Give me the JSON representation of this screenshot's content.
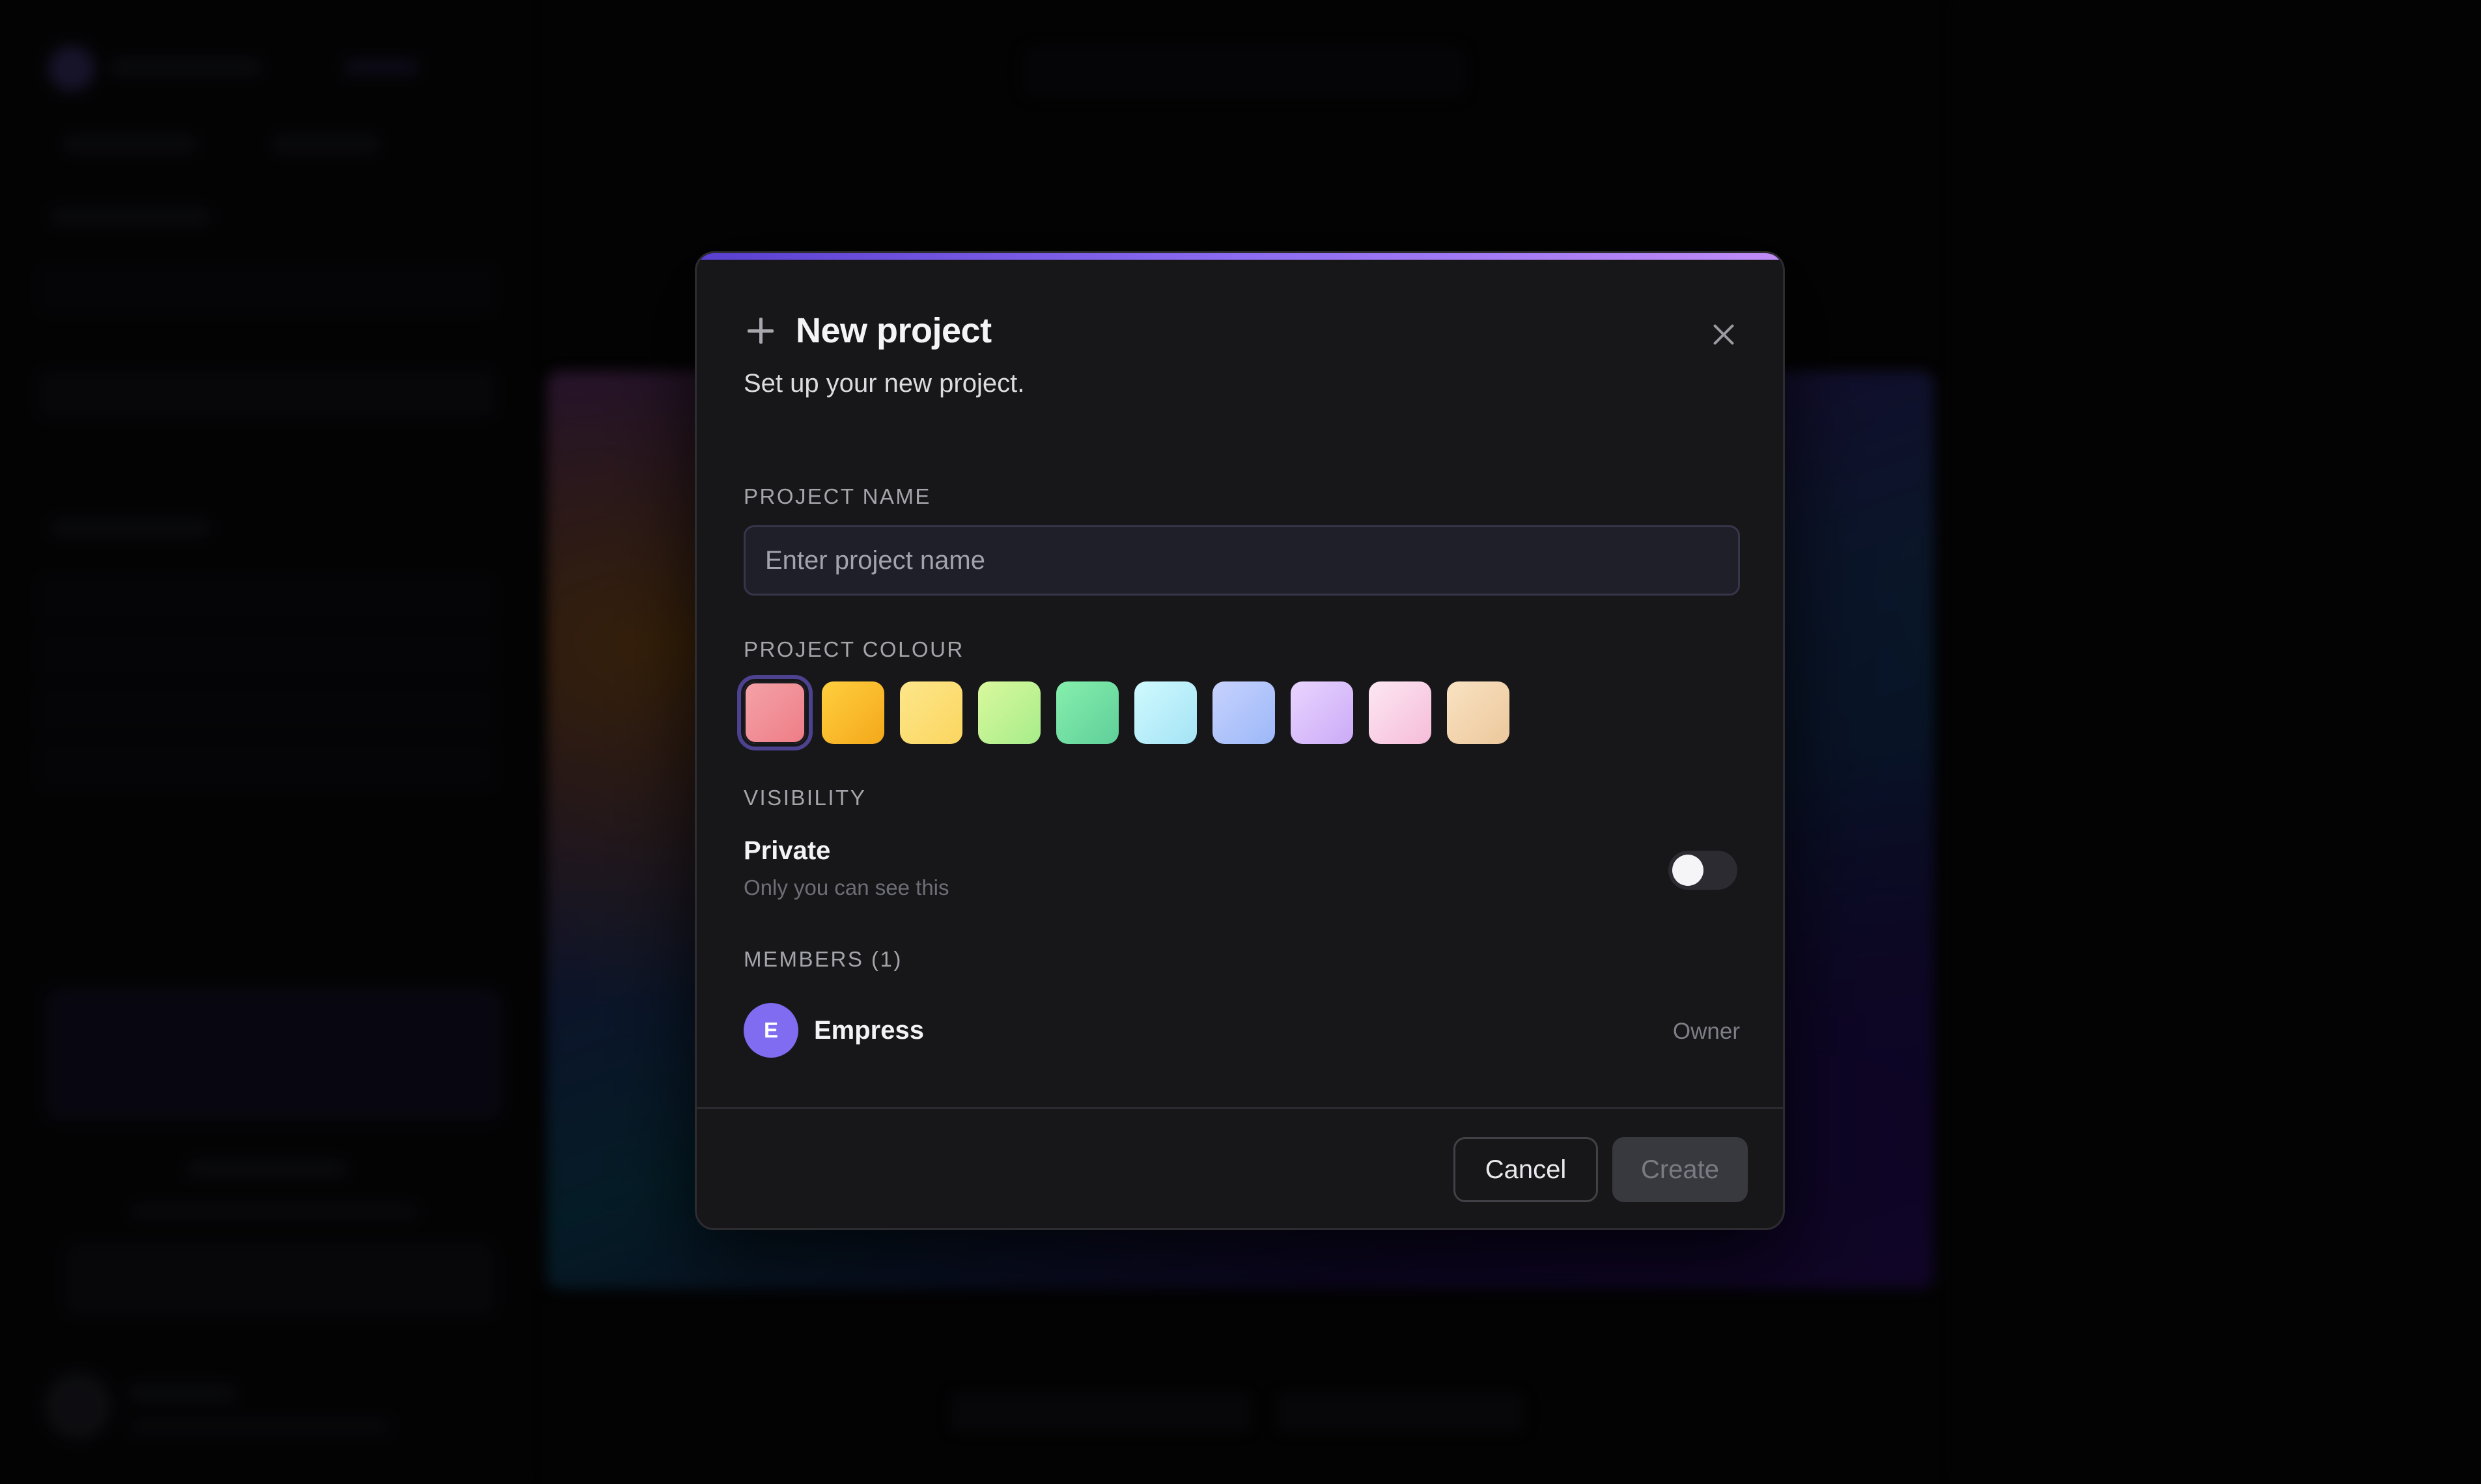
{
  "modal": {
    "title": "New project",
    "subtitle": "Set up your new project.",
    "icons": {
      "header": "plus-icon",
      "close": "close-icon"
    }
  },
  "project_name": {
    "label": "PROJECT NAME",
    "placeholder": "Enter project name",
    "value": ""
  },
  "project_colour": {
    "label": "PROJECT COLOUR",
    "selected_index": 0,
    "swatches": [
      {
        "from": "#f4a3a8",
        "to": "#ee7c86"
      },
      {
        "from": "#ffcf3f",
        "to": "#f4a81a"
      },
      {
        "from": "#fde68a",
        "to": "#fbd660"
      },
      {
        "from": "#d9f99d",
        "to": "#a7ec8a"
      },
      {
        "from": "#86efac",
        "to": "#5fcf9a"
      },
      {
        "from": "#cffafe",
        "to": "#a5e3f5"
      },
      {
        "from": "#c7d2fe",
        "to": "#9cb8f8"
      },
      {
        "from": "#e9d5ff",
        "to": "#cbaaf7"
      },
      {
        "from": "#fce7f3",
        "to": "#f6bcd9"
      },
      {
        "from": "#f9e2c2",
        "to": "#ecc89c"
      }
    ]
  },
  "visibility": {
    "label": "VISIBILITY",
    "option_label": "Private",
    "option_description": "Only you can see this",
    "toggle_on": false
  },
  "members": {
    "label": "MEMBERS (1)",
    "list": [
      {
        "initial": "E",
        "name": "Empress",
        "role": "Owner",
        "avatar_color": "#7f6cf0"
      }
    ]
  },
  "footer": {
    "cancel_label": "Cancel",
    "create_label": "Create"
  },
  "colors": {
    "accent": "#8c6cf2",
    "modal_bg": "#17171a",
    "text_primary": "#f4f4f6",
    "text_muted": "#a4a4ab"
  }
}
